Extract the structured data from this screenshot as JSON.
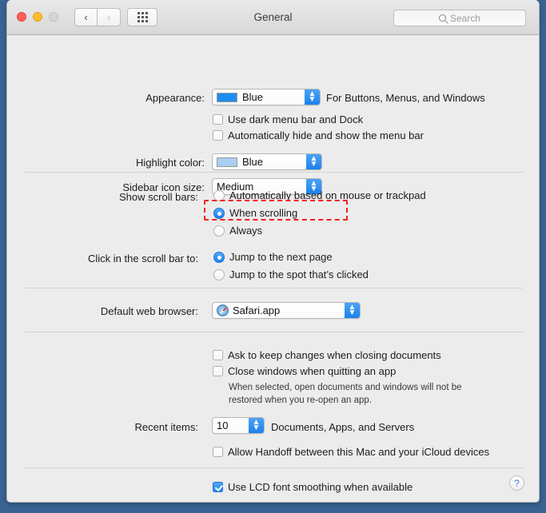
{
  "window": {
    "title": "General",
    "traffic_lights": [
      "close",
      "minimize",
      "zoom"
    ],
    "nav": {
      "back": "‹",
      "forward": "›"
    },
    "show_all_icon": "grid-icon",
    "search": {
      "placeholder": "Search",
      "value": "",
      "icon": "search-icon"
    }
  },
  "appearance": {
    "label": "Appearance:",
    "value": "Blue",
    "swatch_color": "#1e8cf0",
    "hint": "For Buttons, Menus, and Windows",
    "checkboxes": [
      {
        "label": "Use dark menu bar and Dock",
        "checked": false
      },
      {
        "label": "Automatically hide and show the menu bar",
        "checked": false
      }
    ]
  },
  "highlight": {
    "label": "Highlight color:",
    "value": "Blue",
    "swatch_color": "#a8cff2"
  },
  "sidebar_icon_size": {
    "label": "Sidebar icon size:",
    "value": "Medium"
  },
  "scroll_bars": {
    "label": "Show scroll bars:",
    "options": [
      {
        "label": "Automatically based on mouse or trackpad",
        "selected": false
      },
      {
        "label": "When scrolling",
        "selected": true
      },
      {
        "label": "Always",
        "selected": false
      }
    ],
    "annotation_color": "#f41f1f"
  },
  "click_scroll_bar": {
    "label": "Click in the scroll bar to:",
    "options": [
      {
        "label": "Jump to the next page",
        "selected": true
      },
      {
        "label": "Jump to the spot that’s clicked",
        "selected": false
      }
    ]
  },
  "default_browser": {
    "label": "Default web browser:",
    "value": "Safari.app",
    "icon": "safari-icon"
  },
  "documents": {
    "checkboxes": [
      {
        "label": "Ask to keep changes when closing documents",
        "checked": false
      },
      {
        "label": "Close windows when quitting an app",
        "checked": false
      }
    ],
    "note": "When selected, open documents and windows will not be restored when you re-open an app."
  },
  "recent_items": {
    "label": "Recent items:",
    "value": "10",
    "hint": "Documents, Apps, and Servers"
  },
  "handoff": {
    "label": "Allow Handoff between this Mac and your iCloud devices",
    "checked": false
  },
  "font_smoothing": {
    "label": "Use LCD font smoothing when available",
    "checked": true
  },
  "help": {
    "label": "?"
  }
}
